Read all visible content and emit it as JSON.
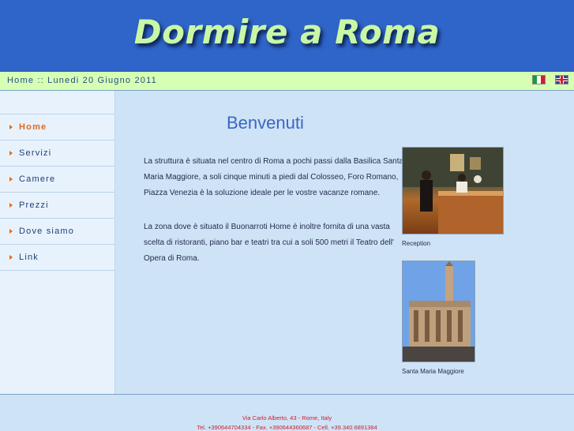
{
  "header": {
    "title": "Dormire a Roma"
  },
  "datebar": {
    "text": "Home :: Lunedi 20 Giugno 2011"
  },
  "languages": [
    {
      "name": "italian-flag-icon",
      "colors": [
        "#1a9a3c",
        "#ffffff",
        "#d0202a"
      ]
    },
    {
      "name": "uk-flag-icon"
    }
  ],
  "nav": {
    "items": [
      {
        "label": "Home",
        "active": true
      },
      {
        "label": "Servizi"
      },
      {
        "label": "Camere"
      },
      {
        "label": "Prezzi"
      },
      {
        "label": "Dove siamo"
      },
      {
        "label": "Link"
      }
    ]
  },
  "main": {
    "title": "Benvenuti",
    "paragraph1": "La struttura è situata nel centro di Roma a pochi passi dalla Basilica Santa Maria Maggiore, a soli cinque minuti a piedi dal Colosseo, Foro Romano, Piazza Venezia è la soluzione ideale per le vostre vacanze romane.",
    "paragraph2": "La zona dove è situato il Buonarroti Home è inoltre fornita di una vasta scelta di ristoranti, piano bar e teatri tra cui a soli 500 metri il Teatro dell' Opera di Roma.",
    "photos": [
      {
        "caption": "Reception"
      },
      {
        "caption": "Santa Maria Maggiore"
      }
    ]
  },
  "footer": {
    "address": "Via Carlo Alberto, 43 - Rome, Italy",
    "contacts": "Tel. +390644704334 - Fax. +390644360687 - Cell. +39.340.6891384"
  },
  "colors": {
    "header_bg": "#2f64c8",
    "title_text": "#c9f7a6",
    "datebar_bg": "#d6ffb4",
    "page_bg": "#cfe3f7",
    "accent": "#e06a1a",
    "footer_text": "#d0202a"
  }
}
